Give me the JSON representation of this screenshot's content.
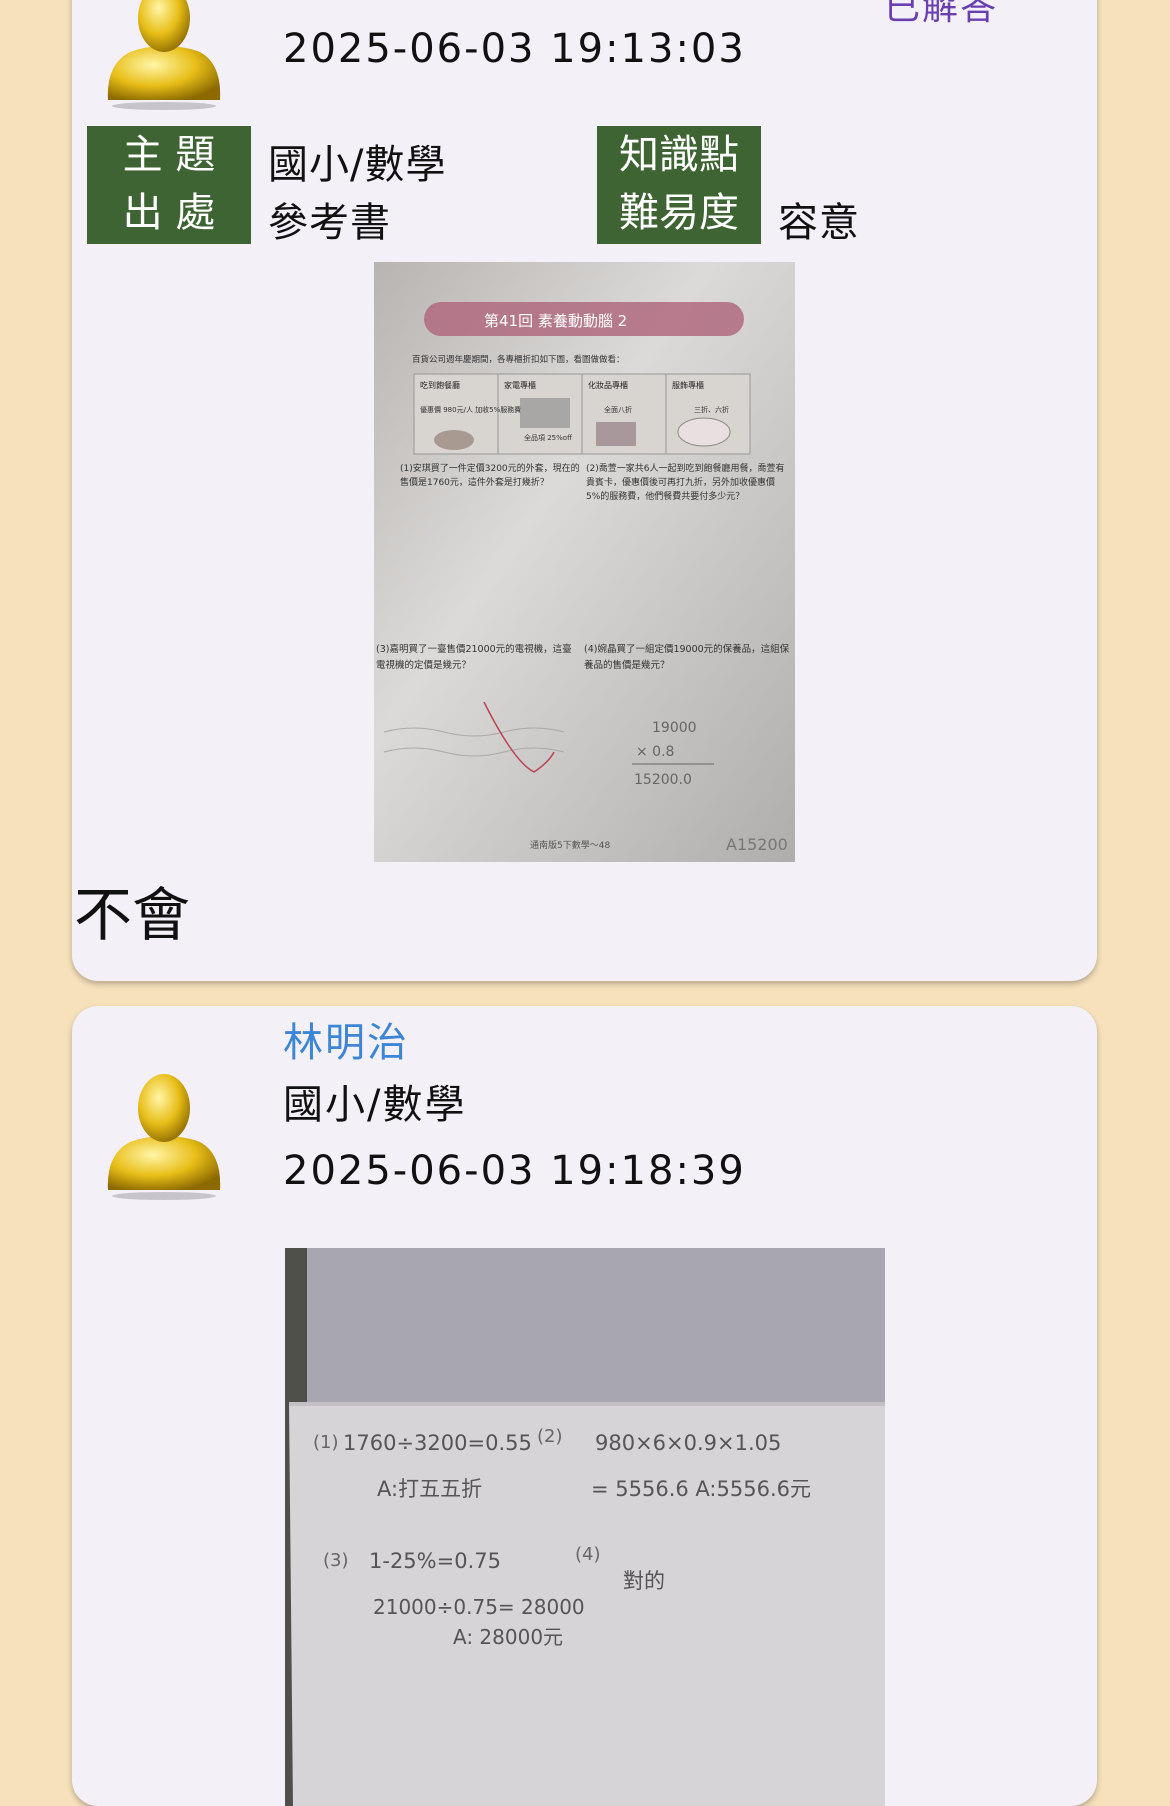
{
  "question_card": {
    "status": "已解答",
    "timestamp": "2025-06-03 19:13:03",
    "labels": {
      "subject": "主 題",
      "source": "出 處",
      "knowledge": "知識點",
      "difficulty": "難易度"
    },
    "values": {
      "subject": "國小/數學",
      "source": "參考書",
      "knowledge": "",
      "difficulty": "容意"
    },
    "body_text": "不會",
    "photo": {
      "header": "第41回  素養動動腦 2",
      "intro": "百貨公司週年慶期間，各專櫃折扣如下圖，看圖做做看：",
      "panels": [
        "吃到飽餐廳",
        "家電專櫃",
        "化妝品專櫃",
        "服飾專櫃"
      ],
      "panel_notes": [
        "優惠價 980元/人 加收5%服務費",
        "全品項 25%off",
        "全面八折",
        "三折、六折"
      ],
      "q1": "(1)安琪買了一件定價3200元的外套，現在的售價是1760元，這件外套是打幾折？",
      "q2": "(2)喬萱一家共6人一起到吃到飽餐廳用餐，喬萱有貴賓卡，優惠價後可再打九折，另外加收優惠價5%的服務費，他們餐費共要付多少元？",
      "q3": "(3)嘉明買了一臺售價21000元的電視機，這臺電視機的定價是幾元？",
      "q4": "(4)婉晶買了一組定價19000元的保養品，這組保養品的售價是幾元？",
      "hand1": "19000",
      "hand2": "× 0.8",
      "hand3": "15200.0",
      "hand4": "A15200",
      "footer": "通南版5下數學～48"
    }
  },
  "answer_card": {
    "username": "林明治",
    "subject": "國小/數學",
    "timestamp": "2025-06-03 19:18:39",
    "photo": {
      "n1": "(1)",
      "l1": "1760÷3200=0.55",
      "l2": "A:打五五折",
      "n2": "(2)",
      "l3": "980×6×0.9×1.05",
      "l4": "= 5556.6   A:5556.6元",
      "n3": "(3)",
      "l5": "1-25%=0.75",
      "l6": "21000÷0.75= 28000",
      "l7": "A: 28000元",
      "n4": "(4)",
      "l8": "對的"
    }
  }
}
